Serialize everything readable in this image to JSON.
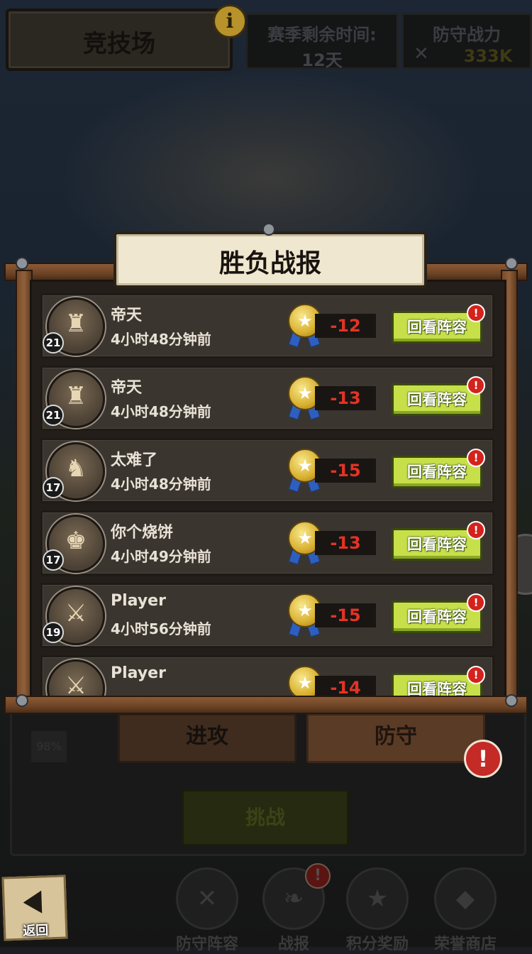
{
  "header": {
    "title": "竞技场",
    "info_icon": "info-icon",
    "season_label": "赛季剩余时间:",
    "season_value": "12天",
    "power_label": "防守战力",
    "power_value": "333K"
  },
  "modal": {
    "title": "胜负战报",
    "records": [
      {
        "name": "帝天",
        "time": "4小时48分钟前",
        "level": "21",
        "score": "-12",
        "button": "回看阵容",
        "avatar_icon": "wizard-avatar-icon"
      },
      {
        "name": "帝天",
        "time": "4小时48分钟前",
        "level": "21",
        "score": "-13",
        "button": "回看阵容",
        "avatar_icon": "wizard-avatar-icon"
      },
      {
        "name": "太难了",
        "time": "4小时48分钟前",
        "level": "17",
        "score": "-15",
        "button": "回看阵容",
        "avatar_icon": "knight-avatar-icon"
      },
      {
        "name": "你个烧饼",
        "time": "4小时49分钟前",
        "level": "17",
        "score": "-13",
        "button": "回看阵容",
        "avatar_icon": "spartan-avatar-icon"
      },
      {
        "name": "Player",
        "time": "4小时56分钟前",
        "level": "19",
        "score": "-15",
        "button": "回看阵容",
        "avatar_icon": "swordsman-avatar-icon"
      },
      {
        "name": "Player",
        "time": "",
        "level": "",
        "score": "-14",
        "button": "回看阵容",
        "avatar_icon": "swordsman-avatar-icon"
      }
    ]
  },
  "tabs": {
    "attack": "进攻",
    "defend": "防守"
  },
  "lower": {
    "percent": "98%",
    "challenge": "挑战"
  },
  "bottom_nav": [
    {
      "label": "防守阵容",
      "icon": "shield-icon"
    },
    {
      "label": "战报",
      "icon": "scroll-icon"
    },
    {
      "label": "积分奖励",
      "icon": "medal-icon"
    },
    {
      "label": "荣誉商店",
      "icon": "gem-icon"
    }
  ],
  "back": {
    "label": "返回"
  },
  "colors": {
    "score_red": "#e23424",
    "replay_green": "#c7e04a",
    "alert_red": "#d4221c",
    "frame_wood": "#8b5a35"
  }
}
